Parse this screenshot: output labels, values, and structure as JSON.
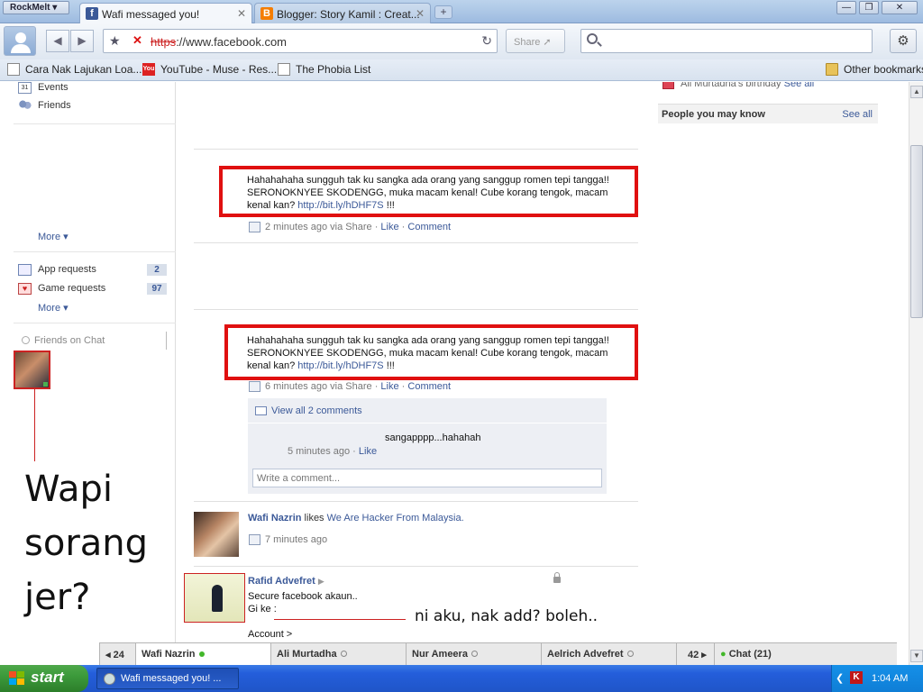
{
  "browser": {
    "menu_label": "RockMelt",
    "tabs": [
      {
        "title": "Wafi messaged you!",
        "icon": "facebook-icon",
        "active": true
      },
      {
        "title": "Blogger: Story Kamil : Creat...",
        "icon": "blogger-icon",
        "active": false
      }
    ],
    "window_controls": {
      "minimize": "—",
      "restore": "❐",
      "close": "✕"
    },
    "address": {
      "protocol": "https",
      "rest": "://www.facebook.com"
    },
    "share_label": "Share",
    "bookmarks": [
      {
        "label": "Cara Nak Lajukan Loa...",
        "icon": "page-icon"
      },
      {
        "label": "YouTube - Muse - Res...",
        "icon": "youtube-icon"
      },
      {
        "label": "The Phobia List",
        "icon": "page-icon"
      }
    ],
    "other_bookmarks": "Other bookmarks"
  },
  "left_nav": {
    "items": [
      {
        "label": "Events",
        "icon": "calendar-icon"
      },
      {
        "label": "Friends",
        "icon": "friends-icon"
      }
    ],
    "more_1": "More",
    "requests": [
      {
        "label": "App requests",
        "count": "2",
        "icon": "app-requests-icon"
      },
      {
        "label": "Game requests",
        "count": "97",
        "icon": "game-requests-icon"
      }
    ],
    "more_2": "More",
    "chat_search_placeholder": "Friends on Chat",
    "annotation": "Wapi sorang jer?"
  },
  "feed": {
    "post1": {
      "text": "Hahahahaha sungguh tak ku sangka ada orang yang sanggup romen tepi tangga!! SERONOKNYEE SKODENGG, muka macam kenal! Cube korang tengok, macam kenal kan? ",
      "link": "http://bit.ly/hDHF7S",
      "suffix": " !!!",
      "time": "2 minutes ago via Share",
      "like": "Like",
      "comment": "Comment"
    },
    "post2": {
      "text": "Hahahahaha sungguh tak ku sangka ada orang yang sanggup romen tepi tangga!! SERONOKNYEE SKODENGG, muka macam kenal! Cube korang tengok, macam kenal kan? ",
      "link": "http://bit.ly/hDHF7S",
      "suffix": " !!!",
      "time": "6 minutes ago via Share",
      "like": "Like",
      "comment": "Comment",
      "view_all": "View all 2 comments",
      "comment_text": "sangapppp...hahahah",
      "comment_time": "5 minutes ago",
      "comment_like": "Like",
      "write_placeholder": "Write a comment..."
    },
    "story3": {
      "name": "Wafi Nazrin",
      "action": " likes ",
      "page": "We Are Hacker From Malaysia.",
      "time": "7 minutes ago"
    },
    "story4": {
      "name": "Rafid Advefret",
      "line1": "Secure facebook akaun..",
      "line2": "Gi ke :",
      "line3": "Account >"
    },
    "annotation": "ni aku, nak add? boleh.."
  },
  "right_col": {
    "birthday": "Ali Murtadha's birthday",
    "birthday_link": "See all",
    "pymk_title": "People you may know",
    "pymk_link": "See all"
  },
  "chat_bar": {
    "left_count": "24",
    "tabs": [
      {
        "name": "Wafi Nazrin",
        "online": true
      },
      {
        "name": "Ali Murtadha",
        "online": false
      },
      {
        "name": "Nur Ameera",
        "online": false
      },
      {
        "name": "Aelrich Advefret",
        "online": false
      }
    ],
    "right_count": "42",
    "chat_label": "Chat (21)"
  },
  "taskbar": {
    "start_label": "start",
    "task_item": "Wafi messaged you! ...",
    "clock": "1:04 AM"
  }
}
